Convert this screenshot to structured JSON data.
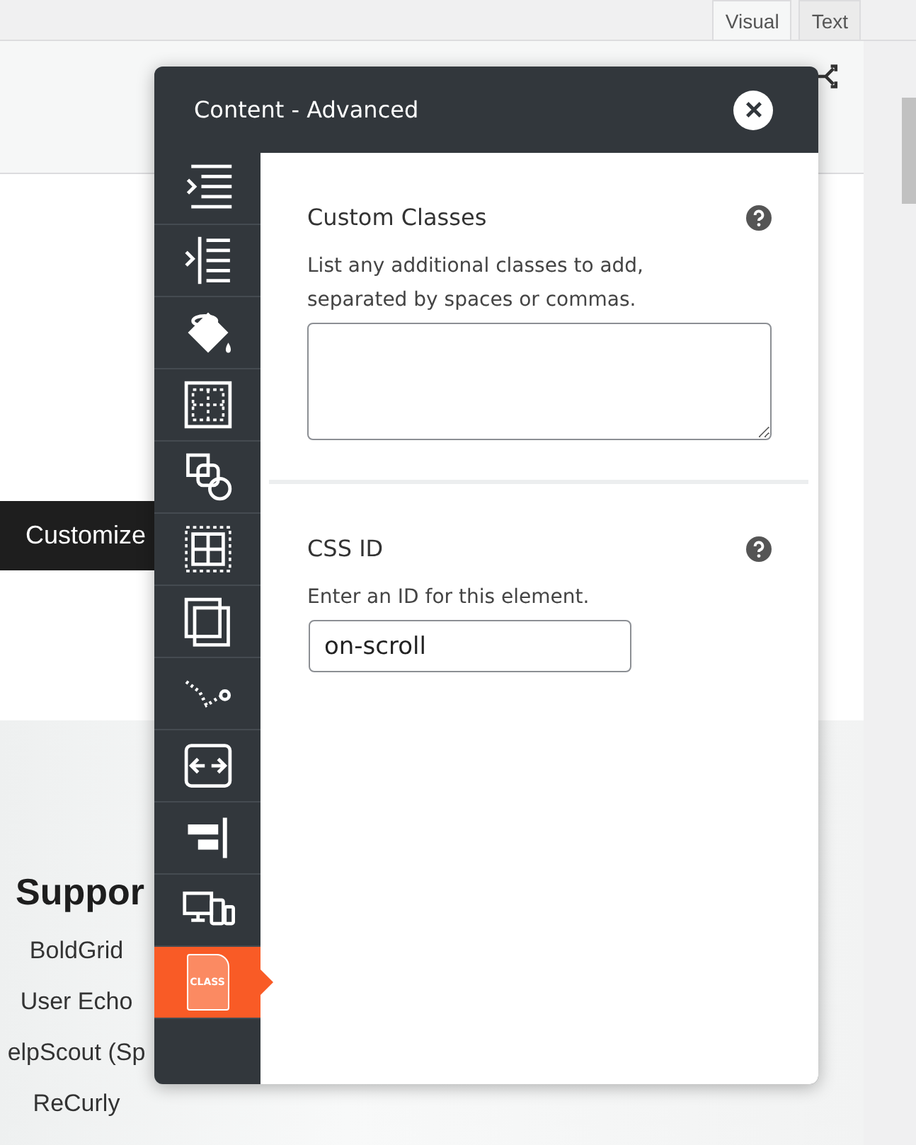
{
  "editor_tabs": [
    {
      "label": "Visual",
      "selected": true
    },
    {
      "label": "Text",
      "selected": false
    }
  ],
  "page": {
    "banner": "Customize",
    "heading": "Suppor",
    "links": [
      "BoldGrid",
      "User Echo",
      "elpScout (Sp",
      "ReCurly"
    ]
  },
  "modal": {
    "title": "Content - Advanced",
    "sidebar": {
      "items": [
        {
          "kind": "indent-right",
          "selected": false
        },
        {
          "kind": "indent-left",
          "selected": false
        },
        {
          "kind": "paint-bucket",
          "selected": false
        },
        {
          "kind": "padding-grid",
          "selected": false
        },
        {
          "kind": "shapes",
          "selected": false
        },
        {
          "kind": "margin-grid",
          "selected": false
        },
        {
          "kind": "layers",
          "selected": false
        },
        {
          "kind": "dotted-path",
          "selected": false
        },
        {
          "kind": "width-arrows",
          "selected": false
        },
        {
          "kind": "align-right",
          "selected": false
        },
        {
          "kind": "devices",
          "selected": false
        },
        {
          "kind": "class-file",
          "selected": true,
          "badge": "CLASS"
        }
      ]
    },
    "fields": [
      {
        "kind": "textarea",
        "label": "Custom Classes",
        "description": "List any additional classes to add, separated by spaces or commas."
      },
      {
        "kind": "input",
        "label": "CSS ID",
        "description": "Enter an ID for this element.",
        "value": "on-scroll"
      }
    ]
  }
}
